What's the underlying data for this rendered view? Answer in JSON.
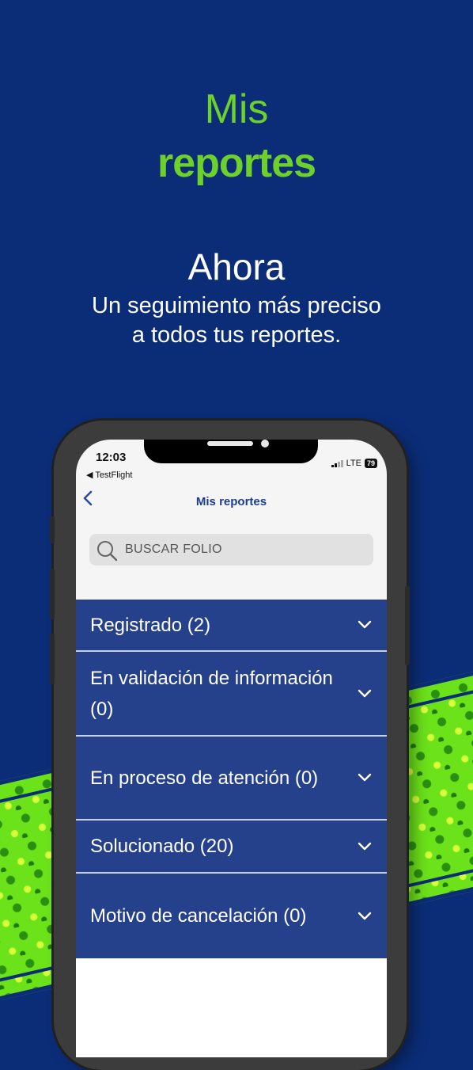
{
  "hero": {
    "title_light": "Mis",
    "title_bold": "reportes",
    "headline": "Ahora",
    "subline_1": "Un seguimiento más preciso",
    "subline_2": "a todos tus reportes."
  },
  "phone": {
    "status": {
      "time": "12:03",
      "back_app": "◀ TestFlight",
      "network": "LTE",
      "battery": "79"
    },
    "nav": {
      "back_icon": "chevron-left-icon",
      "title": "Mis reportes"
    },
    "search": {
      "placeholder": "BUSCAR FOLIO"
    },
    "statuses": [
      {
        "label": "Registrado (2)"
      },
      {
        "label": "En validación de información (0)"
      },
      {
        "label": "En proceso de atención (0)"
      },
      {
        "label": "Solucionado (20)"
      },
      {
        "label": "Motivo de cancelación (0)"
      }
    ]
  },
  "colors": {
    "background": "#0b2d78",
    "accent_green": "#6ed02a",
    "list_item": "#26418c"
  }
}
